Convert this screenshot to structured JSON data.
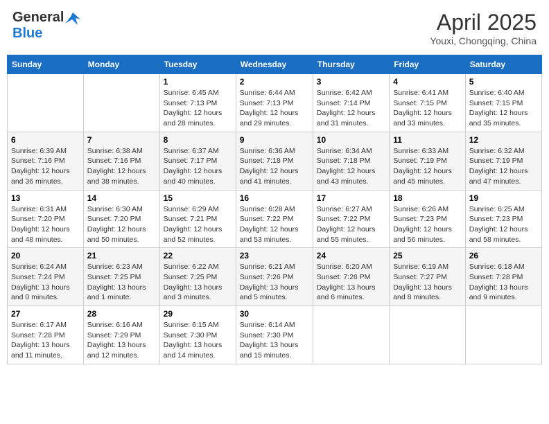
{
  "header": {
    "logo_general": "General",
    "logo_blue": "Blue",
    "month_title": "April 2025",
    "subtitle": "Youxi, Chongqing, China"
  },
  "weekdays": [
    "Sunday",
    "Monday",
    "Tuesday",
    "Wednesday",
    "Thursday",
    "Friday",
    "Saturday"
  ],
  "weeks": [
    [
      {
        "day": "",
        "info": ""
      },
      {
        "day": "",
        "info": ""
      },
      {
        "day": "1",
        "sunrise": "Sunrise: 6:45 AM",
        "sunset": "Sunset: 7:13 PM",
        "daylight": "Daylight: 12 hours and 28 minutes."
      },
      {
        "day": "2",
        "sunrise": "Sunrise: 6:44 AM",
        "sunset": "Sunset: 7:13 PM",
        "daylight": "Daylight: 12 hours and 29 minutes."
      },
      {
        "day": "3",
        "sunrise": "Sunrise: 6:42 AM",
        "sunset": "Sunset: 7:14 PM",
        "daylight": "Daylight: 12 hours and 31 minutes."
      },
      {
        "day": "4",
        "sunrise": "Sunrise: 6:41 AM",
        "sunset": "Sunset: 7:15 PM",
        "daylight": "Daylight: 12 hours and 33 minutes."
      },
      {
        "day": "5",
        "sunrise": "Sunrise: 6:40 AM",
        "sunset": "Sunset: 7:15 PM",
        "daylight": "Daylight: 12 hours and 35 minutes."
      }
    ],
    [
      {
        "day": "6",
        "sunrise": "Sunrise: 6:39 AM",
        "sunset": "Sunset: 7:16 PM",
        "daylight": "Daylight: 12 hours and 36 minutes."
      },
      {
        "day": "7",
        "sunrise": "Sunrise: 6:38 AM",
        "sunset": "Sunset: 7:16 PM",
        "daylight": "Daylight: 12 hours and 38 minutes."
      },
      {
        "day": "8",
        "sunrise": "Sunrise: 6:37 AM",
        "sunset": "Sunset: 7:17 PM",
        "daylight": "Daylight: 12 hours and 40 minutes."
      },
      {
        "day": "9",
        "sunrise": "Sunrise: 6:36 AM",
        "sunset": "Sunset: 7:18 PM",
        "daylight": "Daylight: 12 hours and 41 minutes."
      },
      {
        "day": "10",
        "sunrise": "Sunrise: 6:34 AM",
        "sunset": "Sunset: 7:18 PM",
        "daylight": "Daylight: 12 hours and 43 minutes."
      },
      {
        "day": "11",
        "sunrise": "Sunrise: 6:33 AM",
        "sunset": "Sunset: 7:19 PM",
        "daylight": "Daylight: 12 hours and 45 minutes."
      },
      {
        "day": "12",
        "sunrise": "Sunrise: 6:32 AM",
        "sunset": "Sunset: 7:19 PM",
        "daylight": "Daylight: 12 hours and 47 minutes."
      }
    ],
    [
      {
        "day": "13",
        "sunrise": "Sunrise: 6:31 AM",
        "sunset": "Sunset: 7:20 PM",
        "daylight": "Daylight: 12 hours and 48 minutes."
      },
      {
        "day": "14",
        "sunrise": "Sunrise: 6:30 AM",
        "sunset": "Sunset: 7:20 PM",
        "daylight": "Daylight: 12 hours and 50 minutes."
      },
      {
        "day": "15",
        "sunrise": "Sunrise: 6:29 AM",
        "sunset": "Sunset: 7:21 PM",
        "daylight": "Daylight: 12 hours and 52 minutes."
      },
      {
        "day": "16",
        "sunrise": "Sunrise: 6:28 AM",
        "sunset": "Sunset: 7:22 PM",
        "daylight": "Daylight: 12 hours and 53 minutes."
      },
      {
        "day": "17",
        "sunrise": "Sunrise: 6:27 AM",
        "sunset": "Sunset: 7:22 PM",
        "daylight": "Daylight: 12 hours and 55 minutes."
      },
      {
        "day": "18",
        "sunrise": "Sunrise: 6:26 AM",
        "sunset": "Sunset: 7:23 PM",
        "daylight": "Daylight: 12 hours and 56 minutes."
      },
      {
        "day": "19",
        "sunrise": "Sunrise: 6:25 AM",
        "sunset": "Sunset: 7:23 PM",
        "daylight": "Daylight: 12 hours and 58 minutes."
      }
    ],
    [
      {
        "day": "20",
        "sunrise": "Sunrise: 6:24 AM",
        "sunset": "Sunset: 7:24 PM",
        "daylight": "Daylight: 13 hours and 0 minutes."
      },
      {
        "day": "21",
        "sunrise": "Sunrise: 6:23 AM",
        "sunset": "Sunset: 7:25 PM",
        "daylight": "Daylight: 13 hours and 1 minute."
      },
      {
        "day": "22",
        "sunrise": "Sunrise: 6:22 AM",
        "sunset": "Sunset: 7:25 PM",
        "daylight": "Daylight: 13 hours and 3 minutes."
      },
      {
        "day": "23",
        "sunrise": "Sunrise: 6:21 AM",
        "sunset": "Sunset: 7:26 PM",
        "daylight": "Daylight: 13 hours and 5 minutes."
      },
      {
        "day": "24",
        "sunrise": "Sunrise: 6:20 AM",
        "sunset": "Sunset: 7:26 PM",
        "daylight": "Daylight: 13 hours and 6 minutes."
      },
      {
        "day": "25",
        "sunrise": "Sunrise: 6:19 AM",
        "sunset": "Sunset: 7:27 PM",
        "daylight": "Daylight: 13 hours and 8 minutes."
      },
      {
        "day": "26",
        "sunrise": "Sunrise: 6:18 AM",
        "sunset": "Sunset: 7:28 PM",
        "daylight": "Daylight: 13 hours and 9 minutes."
      }
    ],
    [
      {
        "day": "27",
        "sunrise": "Sunrise: 6:17 AM",
        "sunset": "Sunset: 7:28 PM",
        "daylight": "Daylight: 13 hours and 11 minutes."
      },
      {
        "day": "28",
        "sunrise": "Sunrise: 6:16 AM",
        "sunset": "Sunset: 7:29 PM",
        "daylight": "Daylight: 13 hours and 12 minutes."
      },
      {
        "day": "29",
        "sunrise": "Sunrise: 6:15 AM",
        "sunset": "Sunset: 7:30 PM",
        "daylight": "Daylight: 13 hours and 14 minutes."
      },
      {
        "day": "30",
        "sunrise": "Sunrise: 6:14 AM",
        "sunset": "Sunset: 7:30 PM",
        "daylight": "Daylight: 13 hours and 15 minutes."
      },
      {
        "day": "",
        "info": ""
      },
      {
        "day": "",
        "info": ""
      },
      {
        "day": "",
        "info": ""
      }
    ]
  ]
}
